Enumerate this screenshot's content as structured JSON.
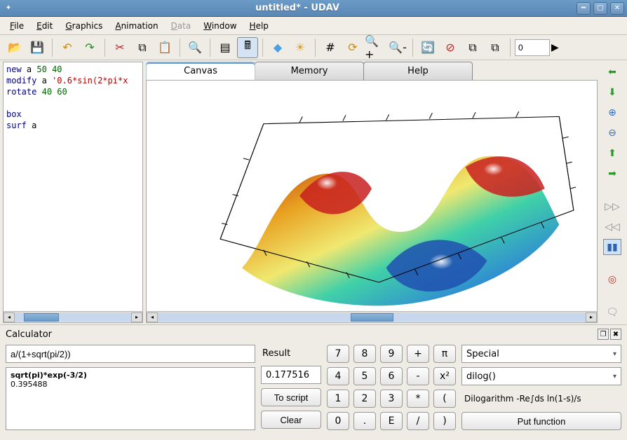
{
  "window": {
    "title": "untitled* - UDAV"
  },
  "menu": {
    "file": "File",
    "edit": "Edit",
    "graphics": "Graphics",
    "animation": "Animation",
    "data": "Data",
    "window": "Window",
    "help": "Help"
  },
  "toolbar": {
    "spin_value": "0"
  },
  "editor": {
    "l1_cmd": "new",
    "l1_var": "a",
    "l1_a1": "50",
    "l1_a2": "40",
    "l2_cmd": "modify",
    "l2_var": "a",
    "l2_str": "'0.6*sin(2*pi*x",
    "l3_cmd": "rotate",
    "l3_a1": "40",
    "l3_a2": "60",
    "blank": "",
    "l4_cmd": "box",
    "l5_cmd": "surf",
    "l5_var": "a"
  },
  "tabs": {
    "canvas": "Canvas",
    "memory": "Memory",
    "help": "Help"
  },
  "calc": {
    "title": "Calculator",
    "expr": "a/(1+sqrt(pi/2))",
    "hist_expr": "sqrt(pi)*exp(-3/2)",
    "hist_val": "0.395488",
    "result_label": "Result",
    "result_value": "0.177516",
    "to_script": "To script",
    "clear": "Clear",
    "special_label": "Special",
    "func": "dilog()",
    "func_desc": "Dilogarithm -Re∫ds ln(1-s)/s",
    "put_function": "Put function",
    "keys": {
      "k7": "7",
      "k8": "8",
      "k9": "9",
      "kplus": "+",
      "kpi": "π",
      "k4": "4",
      "k5": "5",
      "k6": "6",
      "kminus": "-",
      "ksq": "x²",
      "k1": "1",
      "k2": "2",
      "k3": "3",
      "kmul": "*",
      "klp": "(",
      "k0": "0",
      "kdot": ".",
      "kE": "E",
      "kdiv": "/",
      "krp": ")"
    }
  }
}
